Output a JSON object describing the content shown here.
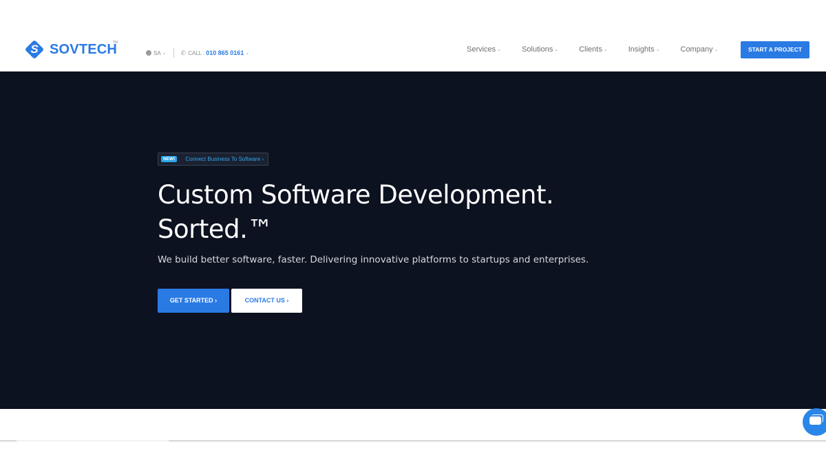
{
  "brand": {
    "name": "SOVTECH",
    "tm": "TM",
    "logo_letter": "S"
  },
  "topinfo": {
    "region": "SA",
    "call_label": "CALL :",
    "phone": "010 865 0161"
  },
  "nav": {
    "items": [
      {
        "label": "Services"
      },
      {
        "label": "Solutions"
      },
      {
        "label": "Clients"
      },
      {
        "label": "Insights"
      },
      {
        "label": "Company"
      }
    ],
    "cta": "START A PROJECT"
  },
  "hero": {
    "badge_new": "NEW!",
    "badge_text": "Connect Business To Software ›",
    "title_line1": "Custom Software Development.",
    "title_line2": "Sorted.™",
    "subtitle": "We build better software, faster. Delivering innovative platforms to startups and enterprises.",
    "primary_button": "GET STARTED  ›",
    "secondary_button": "CONTACT US  ›"
  },
  "colors": {
    "accent": "#2a7ae4",
    "hero_bg": "#0d1220"
  }
}
